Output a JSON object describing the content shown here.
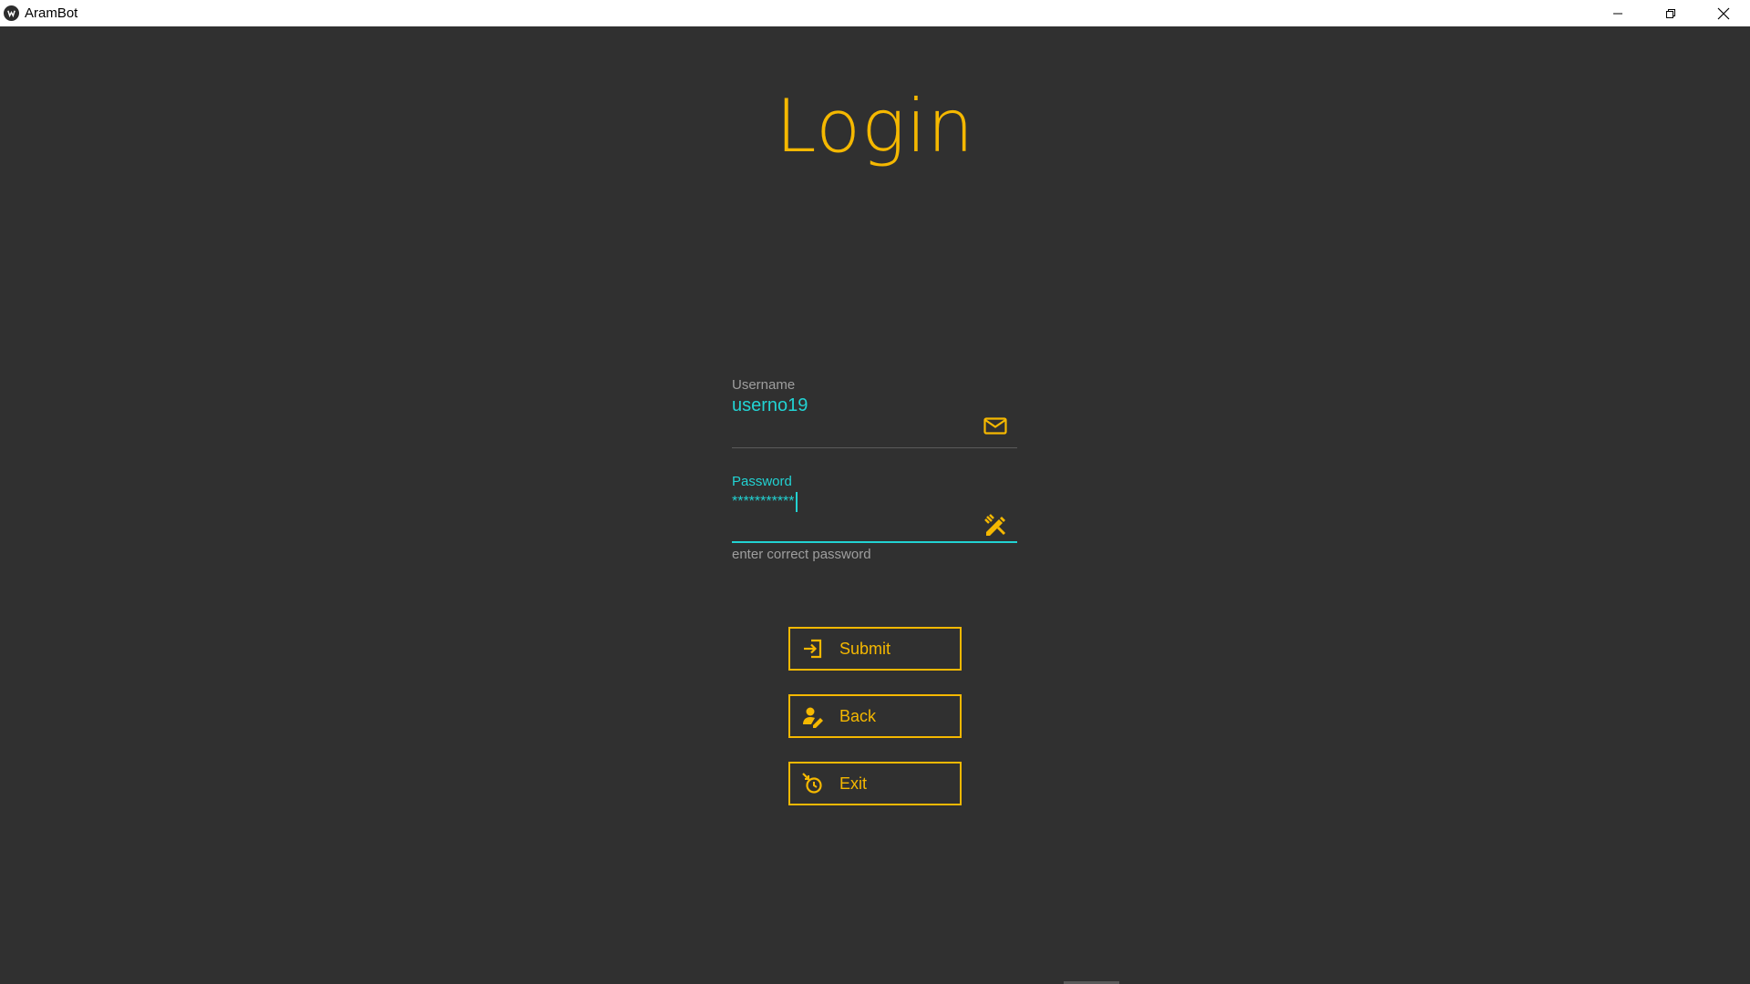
{
  "window": {
    "title": "AramBot"
  },
  "login": {
    "title": "Login",
    "username": {
      "label": "Username",
      "value": "userno19",
      "icon": "email-icon"
    },
    "password": {
      "label": "Password",
      "value": "***********",
      "icon": "pencil-ruler-icon",
      "helper": "enter correct password"
    },
    "buttons": {
      "submit": {
        "label": "Submit",
        "icon": "login-icon"
      },
      "back": {
        "label": "Back",
        "icon": "account-edit-icon"
      },
      "exit": {
        "label": "Exit",
        "icon": "timer-icon"
      }
    }
  },
  "colors": {
    "accent": "#f5b800",
    "focus": "#22d3d3",
    "background": "#303030",
    "muted": "#9e9e9e"
  }
}
